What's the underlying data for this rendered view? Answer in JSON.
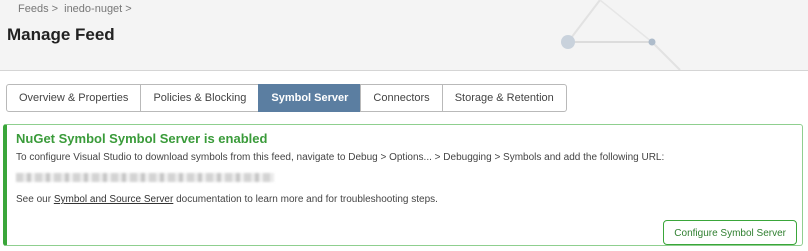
{
  "breadcrumb": {
    "items": [
      "Feeds >",
      "inedo-nuget >"
    ]
  },
  "page": {
    "title": "Manage Feed"
  },
  "tabs": [
    {
      "label": "Overview & Properties",
      "active": false
    },
    {
      "label": "Policies & Blocking",
      "active": false
    },
    {
      "label": "Symbol Server",
      "active": true
    },
    {
      "label": "Connectors",
      "active": false
    },
    {
      "label": "Storage & Retention",
      "active": false
    }
  ],
  "panel": {
    "title": "NuGet Symbol Symbol Server is enabled",
    "description": "To configure Visual Studio to download symbols from this feed, navigate to Debug > Options... > Debugging > Symbols and add the following URL:",
    "see_prefix": "See our ",
    "see_link": "Symbol and Source Server",
    "see_suffix": " documentation to learn more and for troubleshooting steps.",
    "button_label": "Configure Symbol Server"
  },
  "colors": {
    "accent_tab": "#5b7ea1",
    "success_green": "#3aa63a"
  }
}
